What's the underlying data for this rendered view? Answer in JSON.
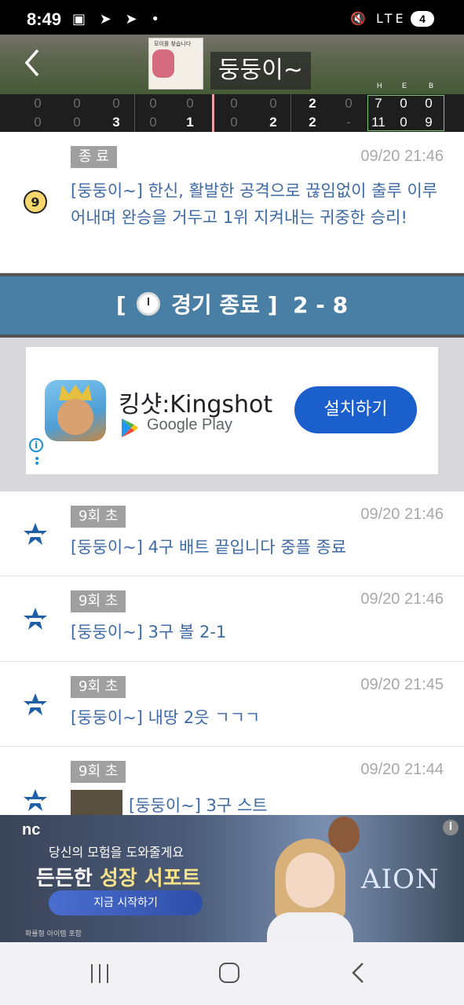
{
  "status_bar": {
    "time": "8:49",
    "battery": "4",
    "network": "LTE"
  },
  "header": {
    "title": "둥둥이~",
    "back_icon": "chevron-left-icon",
    "logo_tiny_text": "모이를 찾습니다"
  },
  "scoreboard": {
    "rhe_labels": [
      "H",
      "E",
      "B"
    ],
    "away": [
      "0",
      "0",
      "0",
      "0",
      "0",
      "0",
      "0",
      "2",
      "0"
    ],
    "home": [
      "0",
      "0",
      "3",
      "0",
      "1",
      "0",
      "2",
      "2",
      "-"
    ],
    "away_rhe": [
      "7",
      "0",
      "0"
    ],
    "home_rhe": [
      "11",
      "0",
      "9"
    ]
  },
  "first_item": {
    "badge": "종 료",
    "timestamp": "09/20  21:46",
    "message": "[둥둥이~] 한신, 활발한 공격으로 끊임없이 출루 이루어내며 완승을 거두고 1위 지켜내는 귀중한 승리!"
  },
  "end_banner": {
    "open_bracket": "[",
    "label": "경기 종료",
    "close_bracket": "]",
    "score": "2 - 8"
  },
  "ad": {
    "app_name": "킹샷:Kingshot",
    "store": "Google Play",
    "install_label": "설치하기"
  },
  "feed": [
    {
      "badge": "9회 초",
      "timestamp": "09/20  21:46",
      "message": "[둥둥이~] 4구 배트 끝입니다 중플 종료"
    },
    {
      "badge": "9회 초",
      "timestamp": "09/20  21:46",
      "message": "[둥둥이~] 3구 볼 2-1"
    },
    {
      "badge": "9회 초",
      "timestamp": "09/20  21:45",
      "message": "[둥둥이~] 내땅 2읏 ㄱㄱㄱ"
    },
    {
      "badge": "9회 초",
      "timestamp": "09/20  21:44",
      "message": "[둥둥이~] 3구 스트"
    }
  ],
  "bottom_ad": {
    "brand": "nc",
    "subtitle": "당신의 모험을 도와줄게요",
    "headline_a": "든든한 ",
    "headline_b": "성장 서포트",
    "cta": "지금 시작하기",
    "fine_print": "확률형 아이템 포함",
    "game_logo": "AION"
  },
  "colors": {
    "accent_blue": "#4a7fa5",
    "message_text": "#3d6aa5",
    "install_button": "#1a5fcc"
  }
}
